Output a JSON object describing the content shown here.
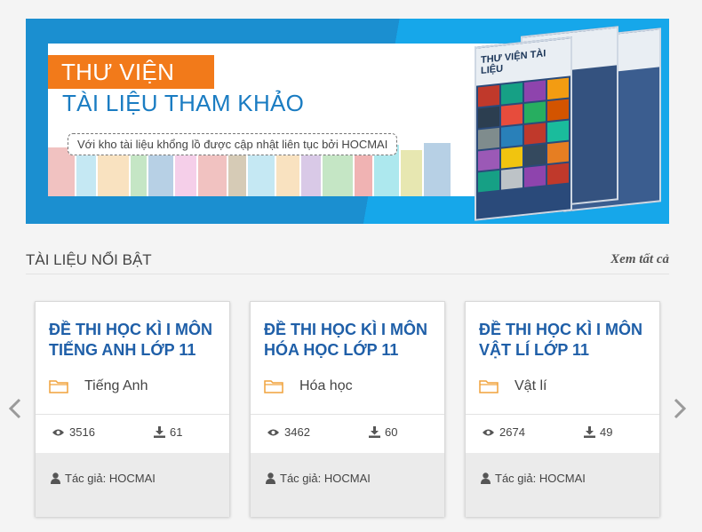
{
  "banner": {
    "badge": "THƯ VIỆN",
    "title": "TÀI LIỆU THAM KHẢO",
    "tagline": "Với kho tài liệu khổng lồ được cập nhật liên tục bởi HOCMAI",
    "book_title": "THƯ VIỆN TÀI LIỆU"
  },
  "section": {
    "title": "TÀI LIỆU NỔI BẬT",
    "see_all": "Xem tất cả"
  },
  "cards": [
    {
      "title": "ĐỀ THI HỌC KÌ I MÔN TIẾNG ANH LỚP 11",
      "subject": "Tiếng Anh",
      "views": "3516",
      "downloads": "61",
      "author": "Tác giả: HOCMAI"
    },
    {
      "title": "ĐỀ THI HỌC KÌ I MÔN HÓA HỌC LỚP 11",
      "subject": "Hóa học",
      "views": "3462",
      "downloads": "60",
      "author": "Tác giả: HOCMAI"
    },
    {
      "title": "ĐỀ THI HỌC KÌ I MÔN VẬT LÍ LỚP 11",
      "subject": "Vật lí",
      "views": "2674",
      "downloads": "49",
      "author": "Tác giả: HOCMAI"
    }
  ],
  "colors": {
    "accent_blue": "#1f5fa8",
    "badge_orange": "#f27a1a",
    "banner_blue": "#1b8fd0"
  },
  "icons": {
    "prev": "chevron-left-icon",
    "next": "chevron-right-icon",
    "subject": "folder-icon",
    "views": "eye-icon",
    "downloads": "download-icon",
    "author": "user-icon"
  }
}
